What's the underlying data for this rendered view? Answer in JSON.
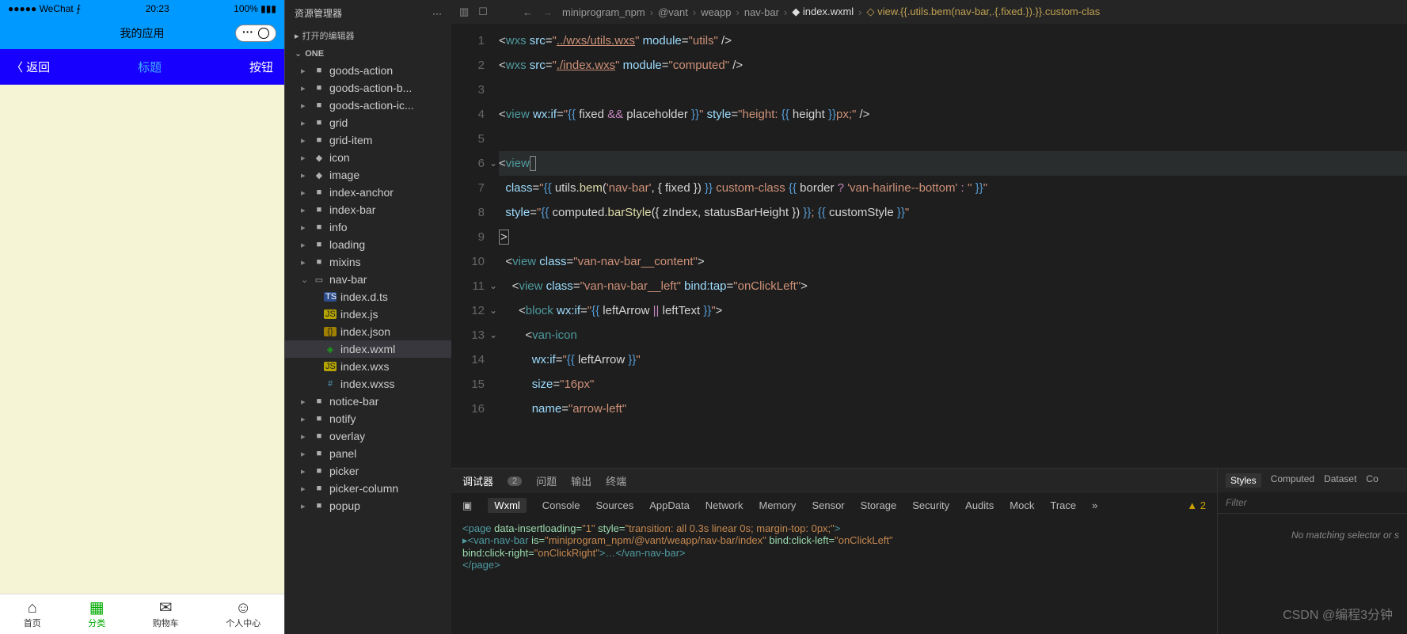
{
  "phone": {
    "status_left": "●●●●● WeChat ⨍",
    "status_time": "20:23",
    "status_right": "100% ▮▮▮",
    "app_title": "我的应用",
    "nav_back": "〈 返回",
    "nav_title": "标题",
    "nav_btn": "按钮",
    "tabs": [
      {
        "icon": "⌂",
        "label": "首页"
      },
      {
        "icon": "▦",
        "label": "分类"
      },
      {
        "icon": "✉",
        "label": "购物车"
      },
      {
        "icon": "☺",
        "label": "个人中心"
      }
    ]
  },
  "explorer": {
    "title": "资源管理器",
    "more": "···",
    "open_editors": "打开的编辑器",
    "root": "ONE",
    "items": [
      {
        "t": "folder",
        "label": "goods-action"
      },
      {
        "t": "folder",
        "label": "goods-action-b..."
      },
      {
        "t": "folder",
        "label": "goods-action-ic..."
      },
      {
        "t": "folder",
        "label": "grid"
      },
      {
        "t": "folder",
        "label": "grid-item"
      },
      {
        "t": "icon",
        "label": "icon"
      },
      {
        "t": "icon",
        "label": "image"
      },
      {
        "t": "folder",
        "label": "index-anchor"
      },
      {
        "t": "folder",
        "label": "index-bar"
      },
      {
        "t": "folder",
        "label": "info"
      },
      {
        "t": "folder",
        "label": "loading"
      },
      {
        "t": "folder",
        "label": "mixins"
      },
      {
        "t": "folder-open",
        "label": "nav-bar"
      },
      {
        "t": "ts",
        "label": "index.d.ts",
        "indent": 1
      },
      {
        "t": "js",
        "label": "index.js",
        "indent": 1
      },
      {
        "t": "json",
        "label": "index.json",
        "indent": 1
      },
      {
        "t": "wxml",
        "label": "index.wxml",
        "indent": 1,
        "sel": true
      },
      {
        "t": "wxs",
        "label": "index.wxs",
        "indent": 1
      },
      {
        "t": "wxss",
        "label": "index.wxss",
        "indent": 1
      },
      {
        "t": "folder",
        "label": "notice-bar"
      },
      {
        "t": "folder",
        "label": "notify"
      },
      {
        "t": "folder",
        "label": "overlay"
      },
      {
        "t": "folder",
        "label": "panel"
      },
      {
        "t": "folder",
        "label": "picker"
      },
      {
        "t": "folder",
        "label": "picker-column"
      },
      {
        "t": "folder",
        "label": "popup"
      }
    ]
  },
  "breadcrumbs": [
    "miniprogram_npm",
    "@vant",
    "weapp",
    "nav-bar",
    "index.wxml",
    "view.{{.utils.bem(nav-bar,.{.fixed.}).}}.custom-clas"
  ],
  "editor_lines": [
    "1",
    "2",
    "3",
    "4",
    "5",
    "6",
    "7",
    "8",
    "9",
    "10",
    "11",
    "12",
    "13",
    "14",
    "15",
    "16"
  ],
  "panel": {
    "tabs": {
      "debug": "调试器",
      "debug_badge": "2",
      "problems": "问题",
      "output": "输出",
      "terminal": "终端"
    },
    "devtabs": [
      "Wxml",
      "Console",
      "Sources",
      "AppData",
      "Network",
      "Memory",
      "Sensor",
      "Storage",
      "Security",
      "Audits",
      "Mock",
      "Trace"
    ],
    "warn": "▲ 2",
    "dom_l1a": "<page ",
    "dom_l1b": "data-insertloading=",
    "dom_l1c": "\"1\"",
    "dom_l1d": " style=",
    "dom_l1e": "\"transition: all 0.3s linear 0s; margin-top: 0px;\"",
    "dom_l1f": ">",
    "dom_l2a": " ▸<van-nav-bar ",
    "dom_l2b": "is=",
    "dom_l2c": "\"miniprogram_npm/@vant/weapp/nav-bar/index\"",
    "dom_l2d": " bind:click-left=",
    "dom_l2e": "\"onClickLeft\"",
    "dom_l3a": "bind:click-right=",
    "dom_l3b": "\"onClickRight\"",
    "dom_l3c": ">…</van-nav-bar>",
    "dom_l4": "</page>",
    "styles": {
      "tabs": [
        "Styles",
        "Computed",
        "Dataset",
        "Co"
      ],
      "filter": "Filter",
      "nomatch": "No matching selector or s"
    }
  },
  "watermark": "CSDN @编程3分钟"
}
